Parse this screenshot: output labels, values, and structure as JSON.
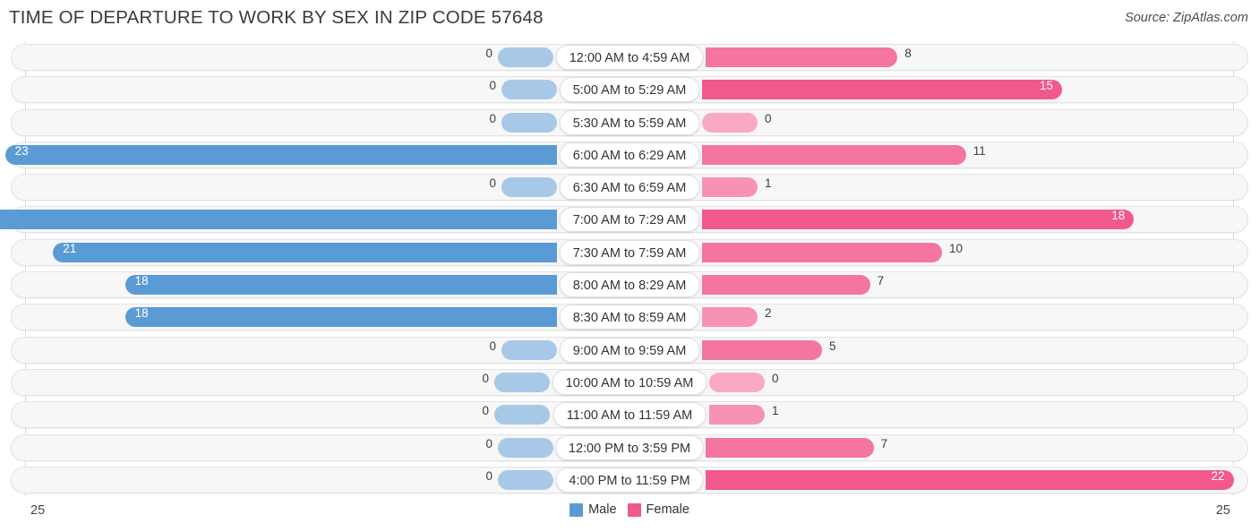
{
  "header": {
    "title": "TIME OF DEPARTURE TO WORK BY SEX IN ZIP CODE 57648",
    "source": "Source: ZipAtlas.com"
  },
  "footer": {
    "tick_left": "25",
    "tick_right": "25"
  },
  "legend": {
    "items": [
      {
        "label": "Male",
        "color": "#5b9bd5"
      },
      {
        "label": "Female",
        "color": "#f0588e"
      }
    ]
  },
  "chart_data": {
    "type": "bar",
    "orientation": "horizontal",
    "style": "diverging-bidirectional",
    "title": "TIME OF DEPARTURE TO WORK BY SEX IN ZIP CODE 57648",
    "xlabel": "",
    "ylabel": "",
    "xlim": [
      25,
      25
    ],
    "axis_max_left": 25,
    "axis_max_right": 25,
    "grid": false,
    "legend_position": "bottom-center",
    "categories": [
      "12:00 AM to 4:59 AM",
      "5:00 AM to 5:29 AM",
      "5:30 AM to 5:59 AM",
      "6:00 AM to 6:29 AM",
      "6:30 AM to 6:59 AM",
      "7:00 AM to 7:29 AM",
      "7:30 AM to 7:59 AM",
      "8:00 AM to 8:29 AM",
      "8:30 AM to 8:59 AM",
      "9:00 AM to 9:59 AM",
      "10:00 AM to 10:59 AM",
      "11:00 AM to 11:59 AM",
      "12:00 PM to 3:59 PM",
      "4:00 PM to 11:59 PM"
    ],
    "series": [
      {
        "name": "Male",
        "color": "#5b9bd5",
        "side": "left",
        "values": [
          0,
          0,
          0,
          23,
          0,
          25,
          21,
          18,
          18,
          0,
          0,
          0,
          0,
          0
        ]
      },
      {
        "name": "Female",
        "color": "#f0588e",
        "side": "right",
        "values": [
          8,
          15,
          0,
          11,
          1,
          18,
          10,
          7,
          2,
          5,
          0,
          1,
          7,
          22
        ]
      }
    ]
  }
}
